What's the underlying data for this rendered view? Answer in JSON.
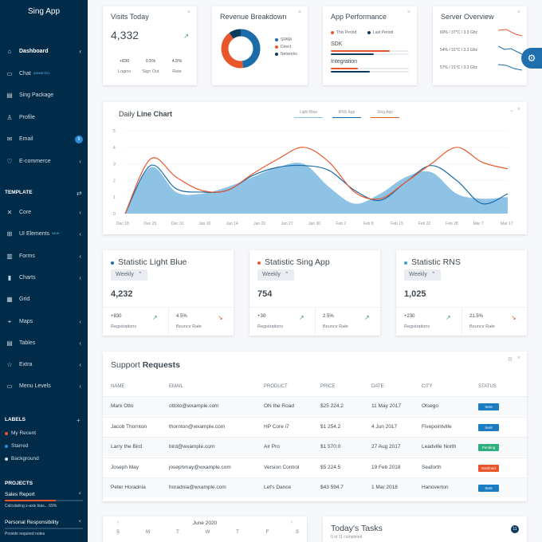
{
  "app": {
    "title": "Sing App"
  },
  "sidebar": {
    "items": [
      {
        "label": "Dashboard",
        "icon": "home-icon",
        "chev": "‹"
      },
      {
        "label": "Chat",
        "icon": "chat-icon",
        "sup": "ANIMATED"
      },
      {
        "label": "Sing Package",
        "icon": "package-icon"
      },
      {
        "label": "Profile",
        "icon": "profile-icon"
      },
      {
        "label": "Email",
        "icon": "email-icon",
        "badge": "9"
      },
      {
        "label": "E-commerce",
        "icon": "ecommerce-icon",
        "chev": "‹"
      }
    ],
    "template_heading": "TEMPLATE",
    "template_action": "⇄",
    "template_items": [
      {
        "label": "Core",
        "icon": "core-icon",
        "chev": "‹"
      },
      {
        "label": "UI Elements",
        "icon": "ui-elements-icon",
        "chev": "‹",
        "sup": "NEW"
      },
      {
        "label": "Forms",
        "icon": "forms-icon",
        "chev": "‹"
      },
      {
        "label": "Charts",
        "icon": "charts-icon",
        "chev": "‹"
      },
      {
        "label": "Grid",
        "icon": "grid-icon"
      },
      {
        "label": "Maps",
        "icon": "maps-icon",
        "chev": "‹"
      },
      {
        "label": "Tables",
        "icon": "tables-icon",
        "chev": "‹"
      },
      {
        "label": "Extra",
        "icon": "extra-icon",
        "chev": "‹"
      },
      {
        "label": "Menu Levels",
        "icon": "menu-levels-icon",
        "chev": "‹"
      }
    ],
    "labels_heading": "LABELS",
    "labels_action": "+",
    "labels": [
      {
        "label": "My Recent",
        "color": "#e8572b"
      },
      {
        "label": "Starred",
        "color": "#2d8cd6"
      },
      {
        "label": "Background",
        "color": "#dfe6ec"
      }
    ],
    "projects_heading": "PROJECTS",
    "projects": [
      {
        "label": "Sales Report",
        "sub": "Calculating x-axis bias... 65%",
        "progress": 0.65,
        "color": "#e8572b"
      },
      {
        "label": "Personal Responsibility",
        "sub": "Provide required notes",
        "progress": 0.0,
        "color": "#2d8cd6"
      }
    ]
  },
  "visits": {
    "title": "Visits Today",
    "value": "4,332",
    "stats": [
      {
        "value": "+830",
        "label": "Logins"
      },
      {
        "value": "0.5%",
        "label": "Sign Out"
      },
      {
        "value": "4.5%",
        "label": "Rate"
      }
    ]
  },
  "revenue": {
    "title": "Revenue Breakdown",
    "legend": [
      {
        "label": "SPAM",
        "color": "#1b6ca8"
      },
      {
        "label": "Direct",
        "color": "#e8572b"
      },
      {
        "label": "Networks",
        "color": "#0b3a5c"
      }
    ],
    "slices": [
      0.48,
      0.42,
      0.1
    ]
  },
  "performance": {
    "title": "App Performance",
    "legend": [
      {
        "label": "This Period",
        "color": "#e8572b"
      },
      {
        "label": "Last Period",
        "color": "#0b3a5c"
      }
    ],
    "rows": [
      {
        "label": "SDK",
        "this": 0.75,
        "last": 0.55
      },
      {
        "label": "Integration",
        "this": 0.35,
        "last": 0.5
      }
    ]
  },
  "server": {
    "title": "Server Overview",
    "rows": [
      {
        "label": "60% / 37°C / 3.3 Ghz",
        "color": "#e8572b"
      },
      {
        "label": "54% / 31°C / 3.3 Ghz",
        "color": "#1b6ca8"
      },
      {
        "label": "57% / 21°C / 3.3 Ghz",
        "color": "#1b6ca8"
      }
    ]
  },
  "daily": {
    "title_pre": "Daily",
    "title_bold": "Line Chart",
    "tabs": [
      {
        "label": "Light Blue",
        "color": "#8ec3e6"
      },
      {
        "label": "RNS App",
        "color": "#1b6ca8"
      },
      {
        "label": "Sing App",
        "color": "#e8572b"
      }
    ]
  },
  "chart_data": {
    "type": "line",
    "title": "Daily Line Chart",
    "x": [
      "Dec 18",
      "Dec 25",
      "Dec 31",
      "Jan 10",
      "Jan 14",
      "Jan 20",
      "Jan 27",
      "Jan 30",
      "Feb 2",
      "Feb 8",
      "Feb 15",
      "Feb 22",
      "Feb 28",
      "Mar 7",
      "Mar 17"
    ],
    "ylim": [
      0,
      5
    ],
    "yticks": [
      0,
      1,
      2,
      3,
      4,
      5
    ],
    "series": [
      {
        "name": "Light Blue",
        "type": "area",
        "color": "#8ec3e6",
        "values": [
          0,
          2.8,
          1.3,
          1.2,
          1.6,
          2.2,
          2.8,
          3.0,
          1.6,
          0.6,
          1.2,
          2.2,
          2.5,
          1.2,
          0.9,
          1.0
        ]
      },
      {
        "name": "RNS App",
        "color": "#1b6ca8",
        "values": [
          0,
          2.9,
          1.5,
          1.3,
          1.4,
          2.3,
          2.8,
          2.9,
          2.6,
          1.4,
          0.8,
          1.9,
          2.9,
          2.0,
          0.6,
          1.2
        ]
      },
      {
        "name": "Sing App",
        "color": "#e8572b",
        "values": [
          0,
          3.3,
          2.2,
          1.4,
          1.4,
          2.4,
          3.3,
          4.0,
          3.1,
          1.3,
          0.9,
          1.9,
          3.0,
          4.0,
          3.1,
          2.7
        ]
      }
    ]
  },
  "stats": [
    {
      "title": "Statistic Light Blue",
      "dot": "#1b6ca8",
      "period": "Weekly",
      "value": "4,232",
      "left": {
        "value": "+830",
        "label": "Registrations",
        "arrow": "↗",
        "arrowColor": "#3d8f8a"
      },
      "right": {
        "value": "4.5%",
        "label": "Bounce Rate",
        "arrow": "↘",
        "arrowColor": "#e8572b"
      }
    },
    {
      "title": "Statistic Sing App",
      "dot": "#e8572b",
      "period": "Weekly",
      "value": "754",
      "left": {
        "value": "+30",
        "label": "Registrations",
        "arrow": "↗",
        "arrowColor": "#3d8f8a"
      },
      "right": {
        "value": "2.5%",
        "label": "Bounce Rate",
        "arrow": "↗",
        "arrowColor": "#3d8f8a"
      }
    },
    {
      "title": "Statistic RNS",
      "dot": "#3ba7c6",
      "period": "Weekly",
      "value": "1,025",
      "left": {
        "value": "+230",
        "label": "Registrations",
        "arrow": "↗",
        "arrowColor": "#3d8f8a"
      },
      "right": {
        "value": "21.5%",
        "label": "Bounce Rate",
        "arrow": "↘",
        "arrowColor": "#e8572b"
      }
    }
  ],
  "support": {
    "title_pre": "Support",
    "title_bold": "Requests",
    "headers": [
      "NAME",
      "EMAIL",
      "PRODUCT",
      "PRICE",
      "DATE",
      "CITY",
      "STATUS"
    ],
    "rows": [
      [
        "Mark Otto",
        "ottoto@wxample.com",
        "ON the Road",
        "$25 224.2",
        "11 May 2017",
        "Otsego",
        "Sent"
      ],
      [
        "Jacob Thornton",
        "thornton@wxample.com",
        "HP Core i7",
        "$1 254.2",
        "4 Jun 2017",
        "Fivepointville",
        "Sent"
      ],
      [
        "Larry the Bird",
        "bird@wxample.com",
        "Air Pro",
        "$1 570.0",
        "27 Aug 2017",
        "Leadville North",
        "Pending"
      ],
      [
        "Joseph May",
        "josephmay@wxample.com",
        "Version Control",
        "$5 224.5",
        "19 Feb 2018",
        "Seaforth",
        "Declined"
      ],
      [
        "Peter Horadnia",
        "horadnia@wxample.com",
        "Let's Dance",
        "$43 594.7",
        "1 Mar 2018",
        "Hanoverton",
        "Sent"
      ]
    ],
    "status_colors": {
      "Sent": "#1b7cc4",
      "Pending": "#2eaf7d",
      "Declined": "#e8572b"
    }
  },
  "calendar": {
    "month": "June 2020",
    "days": [
      "S",
      "M",
      "T",
      "W",
      "T",
      "F",
      "S"
    ]
  },
  "tasks": {
    "title": "Today's Tasks",
    "subtitle": "0 of 11 completed",
    "count": "11"
  },
  "icons": {
    "close": "×",
    "settings": "⚙"
  }
}
